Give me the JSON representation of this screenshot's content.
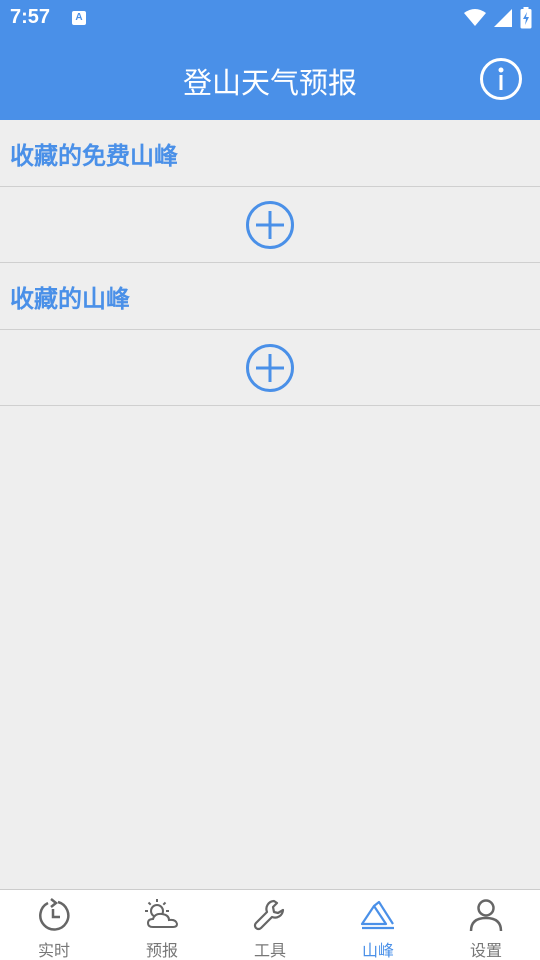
{
  "status_bar": {
    "time": "7:57",
    "app_icon_letter": "A"
  },
  "header": {
    "title": "登山天气预报"
  },
  "sections": [
    {
      "title": "收藏的免费山峰"
    },
    {
      "title": "收藏的山峰"
    }
  ],
  "bottom_nav": {
    "items": [
      {
        "label": "实时",
        "icon": "realtime-clock-icon",
        "active": false
      },
      {
        "label": "预报",
        "icon": "forecast-sun-cloud-icon",
        "active": false
      },
      {
        "label": "工具",
        "icon": "wrench-icon",
        "active": false
      },
      {
        "label": "山峰",
        "icon": "mountain-icon",
        "active": true
      },
      {
        "label": "设置",
        "icon": "person-icon",
        "active": false
      }
    ]
  },
  "colors": {
    "primary": "#4a90e8",
    "background": "#eeeeee",
    "inactive": "#777777"
  }
}
